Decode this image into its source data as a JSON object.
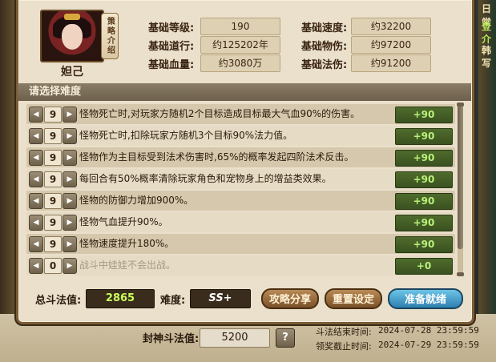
{
  "hero": {
    "name": "妲己",
    "strategy_btn": "策略介绍"
  },
  "stats": [
    {
      "label": "基础等级:",
      "value": "190"
    },
    {
      "label": "基础速度:",
      "value": "约32200"
    },
    {
      "label": "基础道行:",
      "value": "约125202年"
    },
    {
      "label": "基础物伤:",
      "value": "约97200"
    },
    {
      "label": "基础血量:",
      "value": "约3080万"
    },
    {
      "label": "基础法伤:",
      "value": "约91200"
    }
  ],
  "difficulty": {
    "title": "请选择难度",
    "rows": [
      {
        "level": "9",
        "desc": "怪物死亡时,对玩家方随机2个目标造成目标最大气血90%的伤害。",
        "bonus": "+90"
      },
      {
        "level": "9",
        "desc": "怪物死亡时,扣除玩家方随机3个目标90%法力值。",
        "bonus": "+90"
      },
      {
        "level": "9",
        "desc": "怪物作为主目标受到法术伤害时,65%的概率发起四阶法术反击。",
        "bonus": "+90"
      },
      {
        "level": "9",
        "desc": "每回合有50%概率清除玩家角色和宠物身上的增益类效果。",
        "bonus": "+90"
      },
      {
        "level": "9",
        "desc": "怪物的防御力增加900%。",
        "bonus": "+90"
      },
      {
        "level": "9",
        "desc": "怪物气血提升90%。",
        "bonus": "+90"
      },
      {
        "level": "9",
        "desc": "怪物速度提升180%。",
        "bonus": "+90"
      },
      {
        "level": "0",
        "desc": "战斗中娃娃不会出战。",
        "bonus": "+0"
      }
    ]
  },
  "footer": {
    "power_label": "总斗法值:",
    "power_value": "2865",
    "difficulty_label": "难度:",
    "difficulty_value": "SS+",
    "share_btn": "攻略分享",
    "reset_btn": "重置设定",
    "ready_btn": "准备就绪"
  },
  "outside": {
    "seal_label": "封神斗法值:",
    "seal_value": "5200",
    "help": "?",
    "end_label": "斗法结束时间:",
    "end_time": "2024-07-28 23:59:59",
    "reward_label": "领奖截止时间:",
    "reward_time": "2024-07-29 23:59:59",
    "side_1": "日常",
    "side_2": "登",
    "side_3": "介",
    "side_4": "韩",
    "side_5": "写"
  },
  "colors": {
    "panel_bg": "#eae0cb",
    "bonus_text": "#b9f27a",
    "ready_blue": "#2e7fb0"
  }
}
